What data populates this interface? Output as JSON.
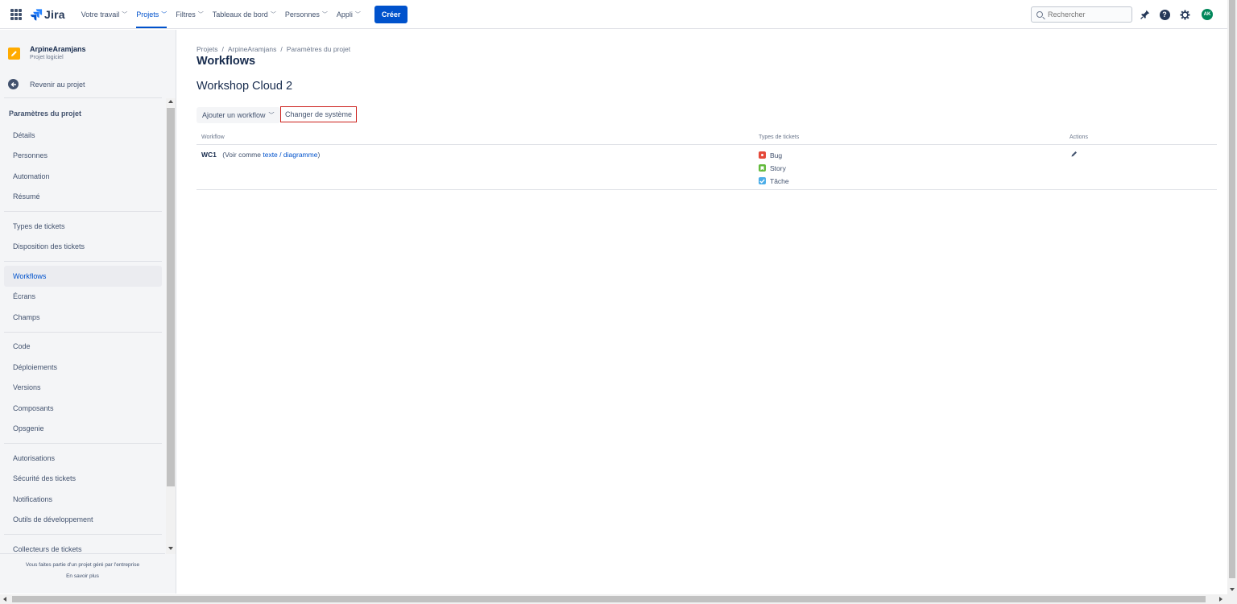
{
  "topnav": {
    "logo_text": "Jira",
    "items": [
      {
        "label": "Votre travail"
      },
      {
        "label": "Projets"
      },
      {
        "label": "Filtres"
      },
      {
        "label": "Tableaux de bord"
      },
      {
        "label": "Personnes"
      },
      {
        "label": "Appli"
      }
    ],
    "create_label": "Créer",
    "search_placeholder": "Rechercher",
    "avatar_initials": "AK"
  },
  "sidebar": {
    "project_name": "ArpineAramjans",
    "project_type": "Projet logiciel",
    "back_label": "Revenir au projet",
    "section_title": "Paramètres du projet",
    "items": [
      {
        "label": "Détails"
      },
      {
        "label": "Personnes"
      },
      {
        "label": "Automation"
      },
      {
        "label": "Résumé"
      },
      {
        "label": "Types de tickets"
      },
      {
        "label": "Disposition des tickets"
      },
      {
        "label": "Workflows"
      },
      {
        "label": "Écrans"
      },
      {
        "label": "Champs"
      },
      {
        "label": "Code"
      },
      {
        "label": "Déploiements"
      },
      {
        "label": "Versions"
      },
      {
        "label": "Composants"
      },
      {
        "label": "Opsgenie"
      },
      {
        "label": "Autorisations"
      },
      {
        "label": "Sécurité des tickets"
      },
      {
        "label": "Notifications"
      },
      {
        "label": "Outils de développement"
      },
      {
        "label": "Collecteurs de tickets"
      }
    ],
    "footer_text": "Vous faites partie d'un projet géré par l'entreprise",
    "footer_link": "En savoir plus"
  },
  "main": {
    "breadcrumb": [
      "Projets",
      "ArpineAramjans",
      "Paramètres du projet"
    ],
    "breadcrumb_sep": "/",
    "page_title": "Workflows",
    "scheme_name": "Workshop Cloud 2",
    "add_workflow_label": "Ajouter un workflow",
    "change_scheme_label": "Changer de système",
    "table": {
      "headers": [
        "Workflow",
        "Types de tickets",
        "Actions"
      ],
      "rows": [
        {
          "name": "WC1",
          "view_prefix": "(Voir comme",
          "link_text": "texte",
          "link_sep": "/",
          "link_diagram": "diagramme",
          "view_suffix": ")",
          "ticket_types": [
            {
              "label": "Bug",
              "color": "#e5493a"
            },
            {
              "label": "Story",
              "color": "#63ba3c"
            },
            {
              "label": "Tâche",
              "color": "#4bade8"
            }
          ]
        }
      ]
    }
  },
  "colors": {
    "brand": "#0052cc",
    "highlight_border": "#cc1f1a",
    "project_icon": "#ffab00",
    "avatar": "#00875a"
  }
}
